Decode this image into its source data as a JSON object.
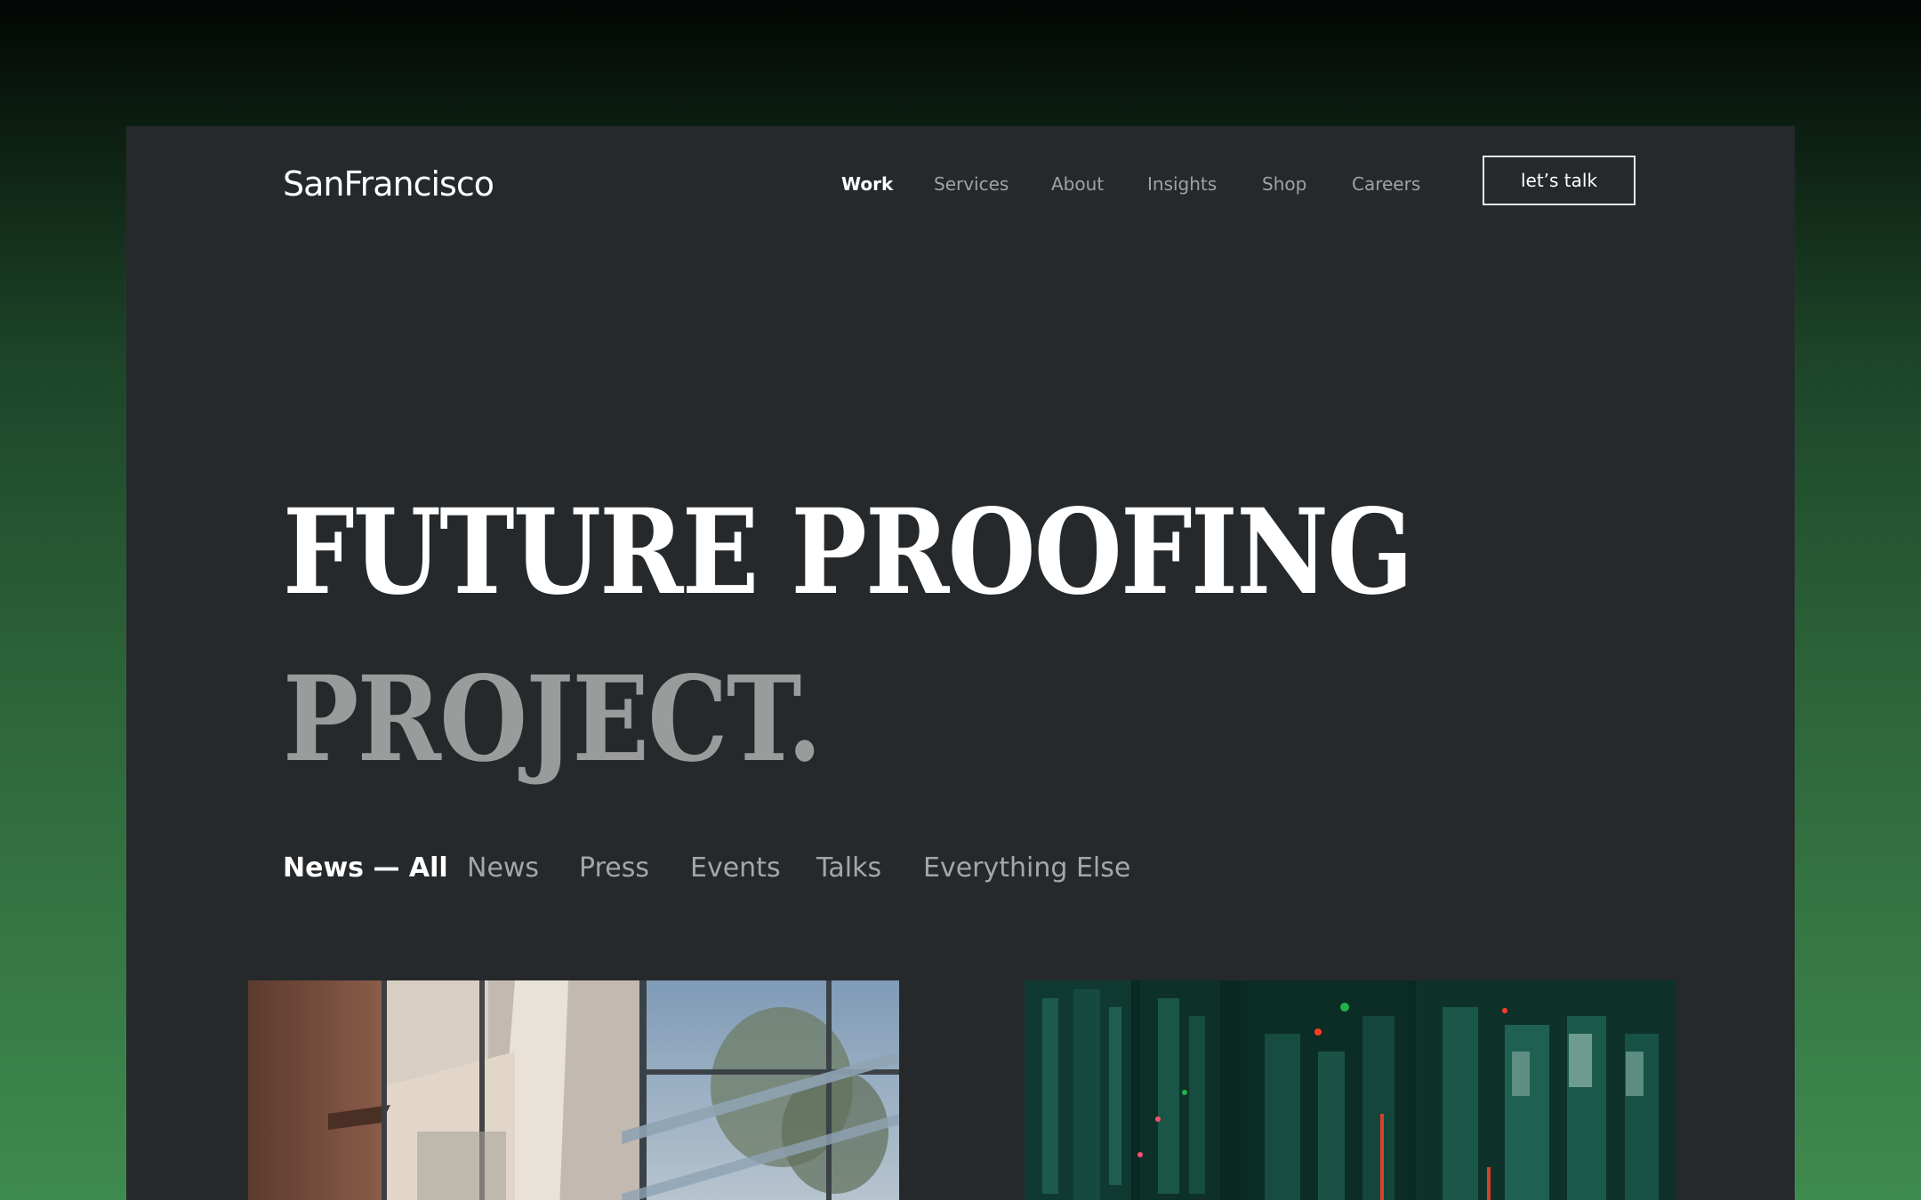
{
  "header": {
    "logo": "SanFrancisco",
    "nav": [
      {
        "label": "Work",
        "active": true
      },
      {
        "label": "Services",
        "active": false
      },
      {
        "label": "About",
        "active": false
      },
      {
        "label": "Insights",
        "active": false
      },
      {
        "label": "Shop",
        "active": false
      },
      {
        "label": "Careers",
        "active": false
      }
    ],
    "cta_label": "let’s talk"
  },
  "hero": {
    "line1": "FUTURE PROOFING",
    "line2": "PROJECT."
  },
  "filters": [
    {
      "label": "News — All",
      "active": true
    },
    {
      "label": "News",
      "active": false
    },
    {
      "label": "Press",
      "active": false
    },
    {
      "label": "Events",
      "active": false
    },
    {
      "label": "Talks",
      "active": false
    },
    {
      "label": "Everything Else",
      "active": false
    }
  ],
  "cards": [
    {
      "icon": "building-photo"
    },
    {
      "icon": "server-rack-photo"
    }
  ],
  "colors": {
    "panel": "#26292c",
    "text_primary": "#ffffff",
    "text_muted": "#9ea2a5",
    "hero_muted": "#9a9b9b",
    "backdrop_green": "#3f8a4f"
  }
}
